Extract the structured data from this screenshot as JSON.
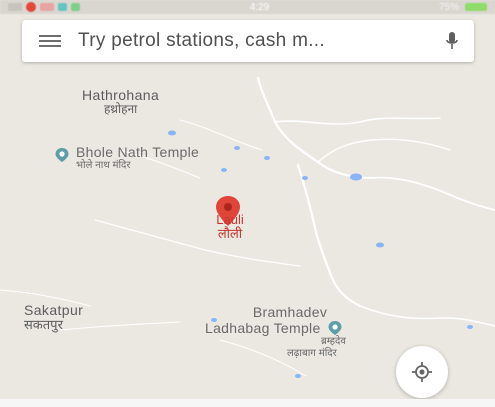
{
  "status_bar": {
    "time": "4:29",
    "battery": "75%"
  },
  "search": {
    "placeholder": "Try petrol stations, cash m..."
  },
  "map": {
    "places": [
      {
        "en": "Hathrohana",
        "hi": "हथ्रोहना"
      },
      {
        "en": "Sakatpur",
        "hi": "सकतपुर"
      }
    ],
    "pois": [
      {
        "en": "Bhole Nath Temple",
        "hi": "भोले नाथ मंदिर"
      },
      {
        "en": "Bramhadev Ladhabag Temple",
        "en_line1": "Bramhadev",
        "en_line2": "Ladhabag Temple",
        "hi_line1": "ब्रम्हदेव",
        "hi_line2": "लढ़ाबाग मंदिर"
      }
    ],
    "pin": {
      "en": "Lauli",
      "hi": "लौली",
      "color": "#e0453a"
    }
  },
  "colors": {
    "map_bg": "#ebe8e2",
    "road": "#ffffff",
    "water": "#8ab4f8",
    "poi": "#5f9ea8",
    "pin": "#e0453a"
  },
  "icons": {
    "menu": "hamburger-icon",
    "mic": "mic-icon",
    "locate": "my-location-icon",
    "temple": "temple-icon"
  }
}
